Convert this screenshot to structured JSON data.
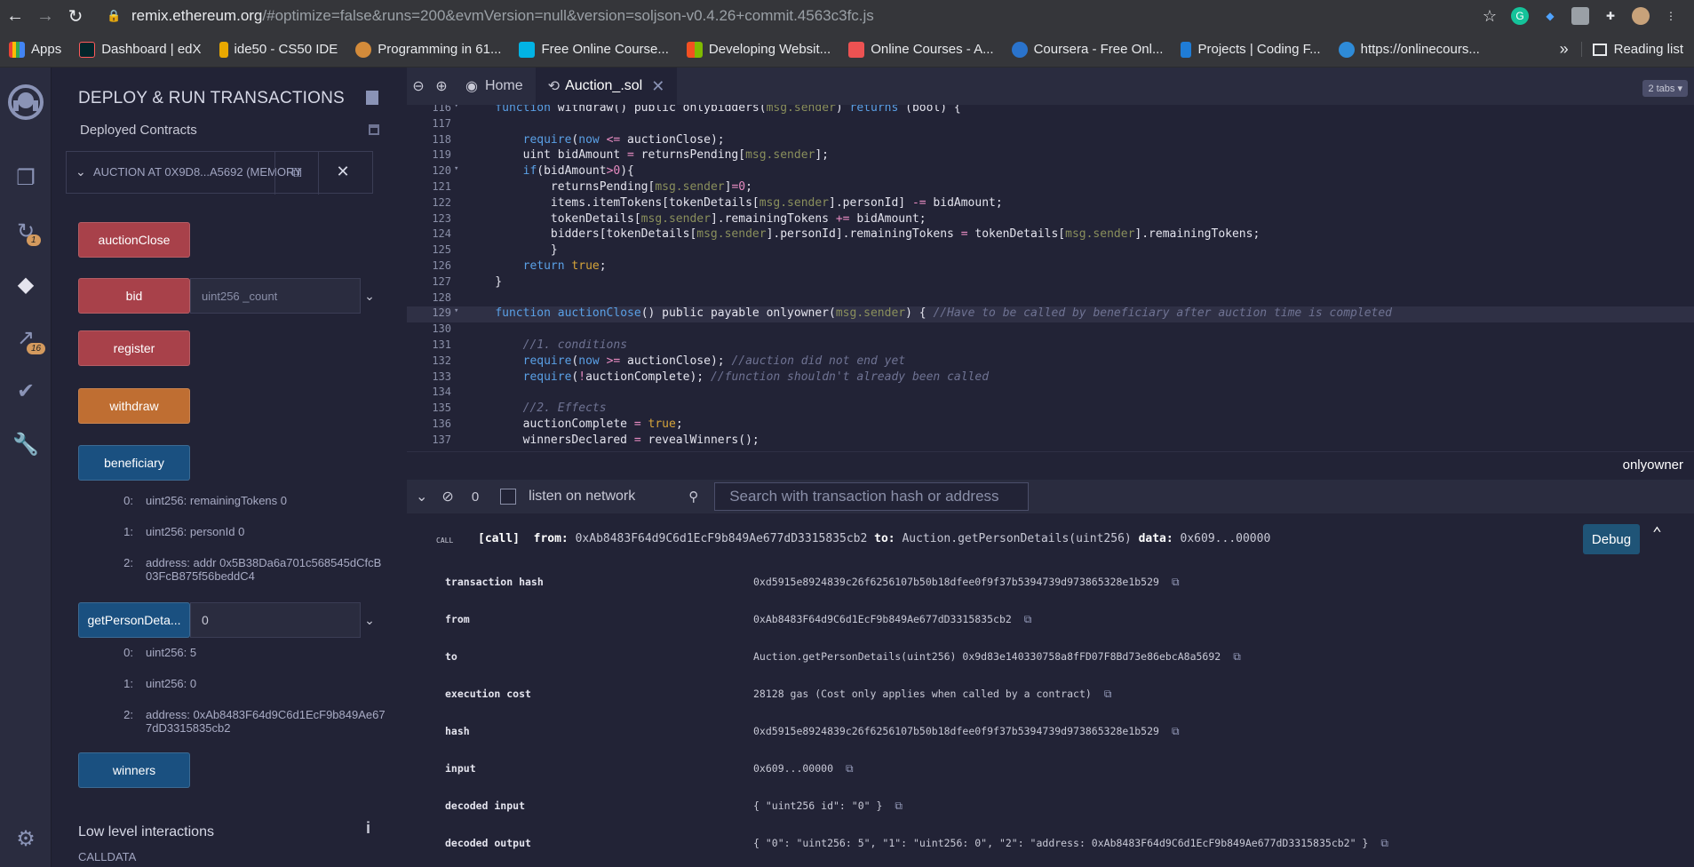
{
  "browser": {
    "url_host": "remix.ethereum.org",
    "url_path": "/#optimize=false&runs=200&evmVersion=null&version=soljson-v0.4.26+commit.4563c3fc.js",
    "bookmarks": [
      "Apps",
      "Dashboard | edX",
      "ide50 - CS50 IDE",
      "Programming in 61...",
      "Free Online Course...",
      "Developing Websit...",
      "Online Courses - A...",
      "Coursera - Free Onl...",
      "Projects | Coding F...",
      "https://onlinecours..."
    ],
    "bookmarks_more": "»",
    "reading_list": "Reading list"
  },
  "rail": {
    "badge_compile": "1",
    "badge_analysis": "16"
  },
  "panel": {
    "title": "DEPLOY & RUN TRANSACTIONS",
    "deployed_label": "Deployed Contracts",
    "instance_name": "AUCTION AT 0X9D8...A5692 (MEMORY",
    "functions": {
      "auctionClose": "auctionClose",
      "bid": "bid",
      "bid_placeholder": "uint256 _count",
      "register": "register",
      "withdraw": "withdraw",
      "beneficiary": "beneficiary",
      "getPersonDetails": "getPersonDeta...",
      "getPersonDetails_value": "0",
      "winners": "winners"
    },
    "beneficiary_outputs": [
      {
        "idx": "0:",
        "text": "uint256: remainingTokens 0"
      },
      {
        "idx": "1:",
        "text": "uint256: personId 0"
      },
      {
        "idx": "2:",
        "text": "address: addr 0x5B38Da6a701c568545dCfcB03FcB875f56beddC4"
      }
    ],
    "person_outputs": [
      {
        "idx": "0:",
        "text": "uint256: 5"
      },
      {
        "idx": "1:",
        "text": "uint256: 0"
      },
      {
        "idx": "2:",
        "text": "address: 0xAb8483F64d9C6d1EcF9b849Ae677dD3315835cb2"
      }
    ],
    "low_level": "Low level interactions",
    "low_level_info": "i",
    "calldata": "CALLDATA"
  },
  "tabs": {
    "home": "Home",
    "file": "Auction_.sol",
    "count": "2 tabs ▾"
  },
  "editor": {
    "lines": [
      {
        "n": "116",
        "fold": "▾",
        "html": "    <span class=\"kw\">function</span> withdraw() public onlybidders(<span class=\"ms\">msg.sender</span>) <span class=\"kw\">returns</span> (bool) {"
      },
      {
        "n": "117",
        "fold": "",
        "html": ""
      },
      {
        "n": "118",
        "fold": "",
        "html": "        <span class=\"kw\">require</span>(<span class=\"kw\">now</span> <span class=\"op\">&lt;=</span> auctionClose);"
      },
      {
        "n": "119",
        "fold": "",
        "html": "        uint bidAmount <span class=\"op\">=</span> returnsPending[<span class=\"ms\">msg.sender</span>];"
      },
      {
        "n": "120",
        "fold": "▾",
        "html": "        <span class=\"kw\">if</span>(bidAmount<span class=\"op\">&gt;</span><span class=\"num\">0</span>){"
      },
      {
        "n": "121",
        "fold": "",
        "html": "            returnsPending[<span class=\"ms\">msg.sender</span>]<span class=\"op\">=</span><span class=\"num\">0</span>;"
      },
      {
        "n": "122",
        "fold": "",
        "html": "            items.itemTokens[tokenDetails[<span class=\"ms\">msg.sender</span>].personId] <span class=\"op\">-=</span> bidAmount;"
      },
      {
        "n": "123",
        "fold": "",
        "html": "            tokenDetails[<span class=\"ms\">msg.sender</span>].remainingTokens <span class=\"op\">+=</span> bidAmount;"
      },
      {
        "n": "124",
        "fold": "",
        "html": "            bidders[tokenDetails[<span class=\"ms\">msg.sender</span>].personId].remainingTokens <span class=\"op\">=</span> tokenDetails[<span class=\"ms\">msg.sender</span>].remainingTokens;"
      },
      {
        "n": "125",
        "fold": "",
        "html": "            }"
      },
      {
        "n": "126",
        "fold": "",
        "html": "        <span class=\"kw\">return</span> <span class=\"bool\">true</span>;"
      },
      {
        "n": "127",
        "fold": "",
        "html": "    }"
      },
      {
        "n": "128",
        "fold": "",
        "html": ""
      },
      {
        "n": "129",
        "fold": "▾",
        "html": "    <span class=\"kw\">function</span> <span class=\"fn\">auctionClose</span>() public payable onlyowner(<span class=\"ms\">msg.sender</span>) { <span class=\"cm\">//Have to be called by beneficiary after auction time is completed</span>"
      },
      {
        "n": "130",
        "fold": "",
        "html": ""
      },
      {
        "n": "131",
        "fold": "",
        "html": "        <span class=\"cm\">//1. conditions</span>"
      },
      {
        "n": "132",
        "fold": "",
        "html": "        <span class=\"kw\">require</span>(<span class=\"kw\">now</span> <span class=\"op\">&gt;=</span> auctionClose); <span class=\"cm\">//auction did not end yet</span>"
      },
      {
        "n": "133",
        "fold": "",
        "html": "        <span class=\"kw\">require</span>(<span class=\"op\">!</span>auctionComplete); <span class=\"cm\">//function shouldn't already been called</span>"
      },
      {
        "n": "134",
        "fold": "",
        "html": ""
      },
      {
        "n": "135",
        "fold": "",
        "html": "        <span class=\"cm\">//2. Effects</span>"
      },
      {
        "n": "136",
        "fold": "",
        "html": "        auctionComplete <span class=\"op\">=</span> <span class=\"bool\">true</span>;"
      },
      {
        "n": "137",
        "fold": "",
        "html": "        winnersDeclared <span class=\"op\">=</span> revealWinners();"
      }
    ],
    "status_text": "onlyowner"
  },
  "terminal": {
    "count": "0",
    "listen_label": "listen on network",
    "search_placeholder": "Search with transaction hash or address",
    "call_tag": "CALL",
    "call_line": "<b>[call]</b>  <b>from:</b> 0xAb8483F64d9C6d1EcF9b849Ae677dD3315835cb2 <b>to:</b> Auction.getPersonDetails(uint256) <b>data:</b> 0x609...00000",
    "debug": "Debug",
    "details": [
      {
        "k": "transaction hash",
        "v": "0xd5915e8924839c26f6256107b50b18dfee0f9f37b5394739d973865328e1b529"
      },
      {
        "k": "from",
        "v": "0xAb8483F64d9C6d1EcF9b849Ae677dD3315835cb2"
      },
      {
        "k": "to",
        "v": "Auction.getPersonDetails(uint256) 0x9d83e140330758a8fFD07F8Bd73e86ebcA8a5692"
      },
      {
        "k": "execution cost",
        "v": "28128 gas (Cost only applies when called by a contract)"
      },
      {
        "k": "hash",
        "v": "0xd5915e8924839c26f6256107b50b18dfee0f9f37b5394739d973865328e1b529"
      },
      {
        "k": "input",
        "v": "0x609...00000"
      },
      {
        "k": "decoded input",
        "v": "{ \"uint256 id\": \"0\" }"
      },
      {
        "k": "decoded output",
        "v": "{ \"0\": \"uint256: 5\", \"1\": \"uint256: 0\", \"2\": \"address: 0xAb8483F64d9C6d1EcF9b849Ae677dD3315835cb2\" }"
      }
    ]
  }
}
